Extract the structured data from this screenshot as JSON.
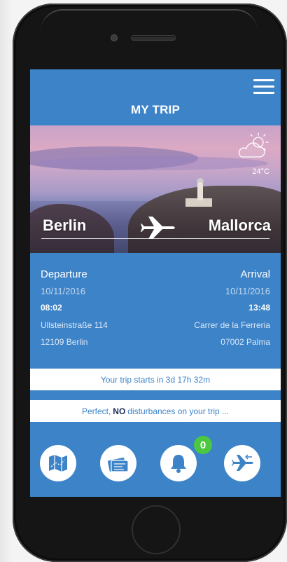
{
  "app": {
    "title": "MY TRIP"
  },
  "weather": {
    "temperature": "24°C",
    "icon": "partly-cloudy-icon"
  },
  "route": {
    "from": "Berlin",
    "to": "Mallorca"
  },
  "departure": {
    "label": "Departure",
    "date": "10/11/2016",
    "time": "08:02",
    "street": "Ullsteinstraße 114",
    "city": "12109 Berlin"
  },
  "arrival": {
    "label": "Arrival",
    "date": "10/11/2016",
    "time": "13:48",
    "street": "Carrer de la Ferreria",
    "city": "07002 Palma"
  },
  "countdown": "Your trip starts in 3d 17h 32m",
  "status": {
    "prefix": "Perfect,",
    "emphasis": "NO",
    "suffix": "disturbances on your trip ..."
  },
  "actions": {
    "notifications_count": "0",
    "icons": [
      "map-icon",
      "tickets-icon",
      "bell-icon",
      "return-flight-icon"
    ]
  },
  "colors": {
    "primary": "#3d83c8",
    "badge": "#4cc840"
  }
}
